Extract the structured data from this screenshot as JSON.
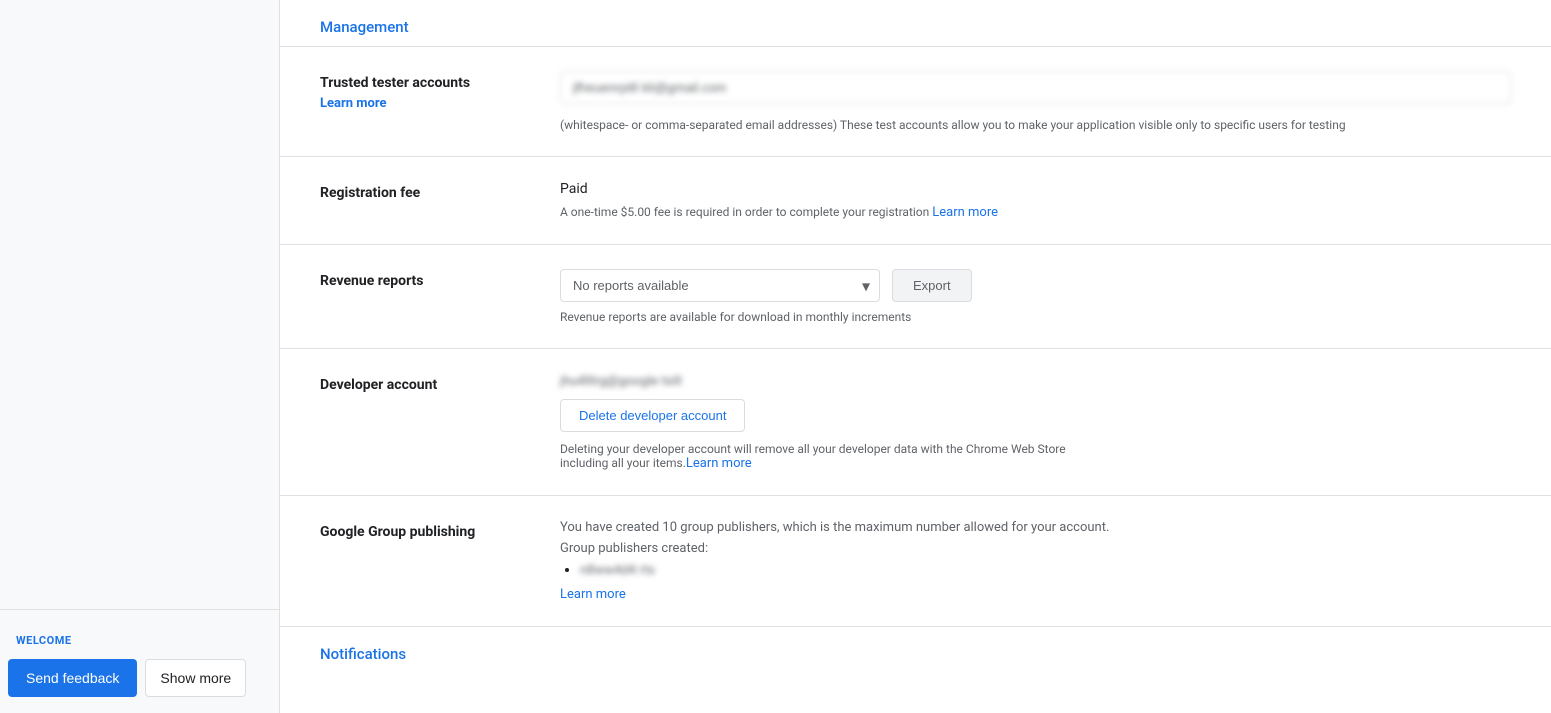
{
  "sidebar": {
    "welcome_label": "WELCOME",
    "send_feedback_label": "Send feedback",
    "show_more_label": "Show more"
  },
  "management": {
    "section_title": "Management",
    "trusted_tester": {
      "label": "Trusted tester accounts",
      "learn_more": "Learn more",
      "input_value": "jfheuenrpt8 kli@gmail.com",
      "helper_text": "(whitespace- or comma-separated email addresses) These test accounts allow you to make your application visible only to specific users for testing"
    },
    "registration_fee": {
      "label": "Registration fee",
      "status": "Paid",
      "info_prefix": "A one-time $5.00 fee is required in order to complete your registration ",
      "learn_more": "Learn more"
    },
    "revenue_reports": {
      "label": "Revenue reports",
      "dropdown_value": "No reports available",
      "export_label": "Export",
      "helper_text": "Revenue reports are available for download in monthly increments"
    },
    "developer_account": {
      "label": "Developer account",
      "email_blurred": "jhu4lltrg@google tsill",
      "delete_btn_label": "Delete developer account",
      "warning_text": "Deleting your developer account will remove all your developer data with the Chrome Web Store including all your items.",
      "learn_more": "Learn more"
    },
    "google_group_publishing": {
      "label": "Google Group publishing",
      "info_text": "You have created 10 group publishers, which is the maximum number allowed for your account.",
      "created_label": "Group publishers created:",
      "publisher_blurred": "n8ww4d4 rts",
      "learn_more": "Learn more"
    }
  },
  "notifications": {
    "section_title": "Notifications"
  }
}
